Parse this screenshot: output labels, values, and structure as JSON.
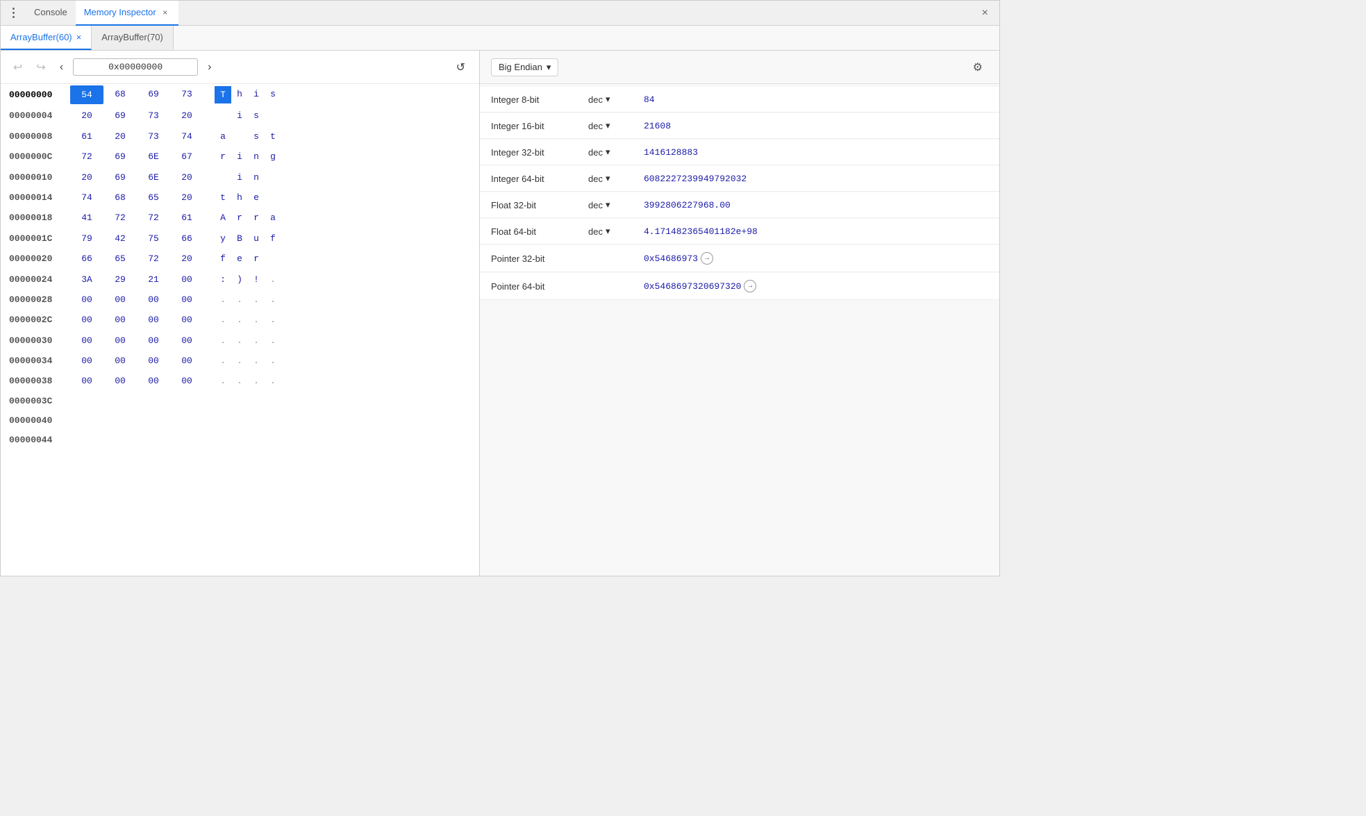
{
  "window": {
    "title": "Memory Inspector",
    "close_label": "×"
  },
  "top_tabs": [
    {
      "id": "console",
      "label": "Console",
      "active": false,
      "closeable": false
    },
    {
      "id": "memory-inspector",
      "label": "Memory Inspector",
      "active": true,
      "closeable": true
    }
  ],
  "buffer_tabs": [
    {
      "id": "buffer60",
      "label": "ArrayBuffer(60)",
      "active": true,
      "closeable": true
    },
    {
      "id": "buffer70",
      "label": "ArrayBuffer(70)",
      "active": false,
      "closeable": false
    }
  ],
  "address_bar": {
    "back_label": "‹",
    "forward_label": "›",
    "address": "0x00000000",
    "refresh_label": "↺"
  },
  "endian": {
    "label": "Big Endian",
    "dropdown_arrow": "▾"
  },
  "gear_label": "⚙",
  "hex_rows": [
    {
      "addr": "00000000",
      "bytes": [
        "54",
        "68",
        "69",
        "73"
      ],
      "chars": [
        "T",
        "h",
        "i",
        "s"
      ],
      "byte_selected": [
        0
      ],
      "char_selected": [
        0
      ]
    },
    {
      "addr": "00000004",
      "bytes": [
        "20",
        "69",
        "73",
        "20"
      ],
      "chars": [
        " ",
        "i",
        "s",
        " "
      ],
      "byte_selected": [],
      "char_selected": []
    },
    {
      "addr": "00000008",
      "bytes": [
        "61",
        "20",
        "73",
        "74"
      ],
      "chars": [
        "a",
        " ",
        "s",
        "t"
      ],
      "byte_selected": [],
      "char_selected": []
    },
    {
      "addr": "0000000C",
      "bytes": [
        "72",
        "69",
        "6E",
        "67"
      ],
      "chars": [
        "r",
        "i",
        "n",
        "g"
      ],
      "byte_selected": [],
      "char_selected": []
    },
    {
      "addr": "00000010",
      "bytes": [
        "20",
        "69",
        "6E",
        "20"
      ],
      "chars": [
        " ",
        "i",
        "n",
        " "
      ],
      "byte_selected": [],
      "char_selected": []
    },
    {
      "addr": "00000014",
      "bytes": [
        "74",
        "68",
        "65",
        "20"
      ],
      "chars": [
        "t",
        "h",
        "e",
        " "
      ],
      "byte_selected": [],
      "char_selected": []
    },
    {
      "addr": "00000018",
      "bytes": [
        "41",
        "72",
        "72",
        "61"
      ],
      "chars": [
        "A",
        "r",
        "r",
        "a"
      ],
      "byte_selected": [],
      "char_selected": []
    },
    {
      "addr": "0000001C",
      "bytes": [
        "79",
        "42",
        "75",
        "66"
      ],
      "chars": [
        "y",
        "B",
        "u",
        "f"
      ],
      "byte_selected": [],
      "char_selected": []
    },
    {
      "addr": "00000020",
      "bytes": [
        "66",
        "65",
        "72",
        "20"
      ],
      "chars": [
        "f",
        "e",
        "r",
        " "
      ],
      "byte_selected": [],
      "char_selected": []
    },
    {
      "addr": "00000024",
      "bytes": [
        "3A",
        "29",
        "21",
        "00"
      ],
      "chars": [
        ":",
        ")",
        "!",
        "."
      ],
      "byte_selected": [],
      "char_selected": []
    },
    {
      "addr": "00000028",
      "bytes": [
        "00",
        "00",
        "00",
        "00"
      ],
      "chars": [
        ".",
        ".",
        ".",
        "."
      ],
      "byte_selected": [],
      "char_selected": []
    },
    {
      "addr": "0000002C",
      "bytes": [
        "00",
        "00",
        "00",
        "00"
      ],
      "chars": [
        ".",
        ".",
        ".",
        "."
      ],
      "byte_selected": [],
      "char_selected": []
    },
    {
      "addr": "00000030",
      "bytes": [
        "00",
        "00",
        "00",
        "00"
      ],
      "chars": [
        ".",
        ".",
        ".",
        "."
      ],
      "byte_selected": [],
      "char_selected": []
    },
    {
      "addr": "00000034",
      "bytes": [
        "00",
        "00",
        "00",
        "00"
      ],
      "chars": [
        ".",
        ".",
        ".",
        "."
      ],
      "byte_selected": [],
      "char_selected": []
    },
    {
      "addr": "00000038",
      "bytes": [
        "00",
        "00",
        "00",
        "00"
      ],
      "chars": [
        ".",
        ".",
        ".",
        "."
      ],
      "byte_selected": [],
      "char_selected": []
    },
    {
      "addr": "0000003C",
      "bytes": [],
      "chars": [],
      "byte_selected": [],
      "char_selected": []
    },
    {
      "addr": "00000040",
      "bytes": [],
      "chars": [],
      "byte_selected": [],
      "char_selected": []
    },
    {
      "addr": "00000044",
      "bytes": [],
      "chars": [],
      "byte_selected": [],
      "char_selected": []
    }
  ],
  "value_rows": [
    {
      "type": "Integer 8-bit",
      "format": "dec",
      "has_dropdown": true,
      "value": "84",
      "is_pointer": false
    },
    {
      "type": "Integer 16-bit",
      "format": "dec",
      "has_dropdown": true,
      "value": "21608",
      "is_pointer": false
    },
    {
      "type": "Integer 32-bit",
      "format": "dec",
      "has_dropdown": true,
      "value": "1416128883",
      "is_pointer": false
    },
    {
      "type": "Integer 64-bit",
      "format": "dec",
      "has_dropdown": true,
      "value": "6082227239949792032",
      "is_pointer": false
    },
    {
      "type": "Float 32-bit",
      "format": "dec",
      "has_dropdown": true,
      "value": "3992806227968.00",
      "is_pointer": false
    },
    {
      "type": "Float 64-bit",
      "format": "dec",
      "has_dropdown": true,
      "value": "4.171482365401182e+98",
      "is_pointer": false
    },
    {
      "type": "Pointer 32-bit",
      "format": "",
      "has_dropdown": false,
      "value": "0x54686973",
      "is_pointer": true
    },
    {
      "type": "Pointer 64-bit",
      "format": "",
      "has_dropdown": false,
      "value": "0x5468697320697320",
      "is_pointer": true
    }
  ]
}
